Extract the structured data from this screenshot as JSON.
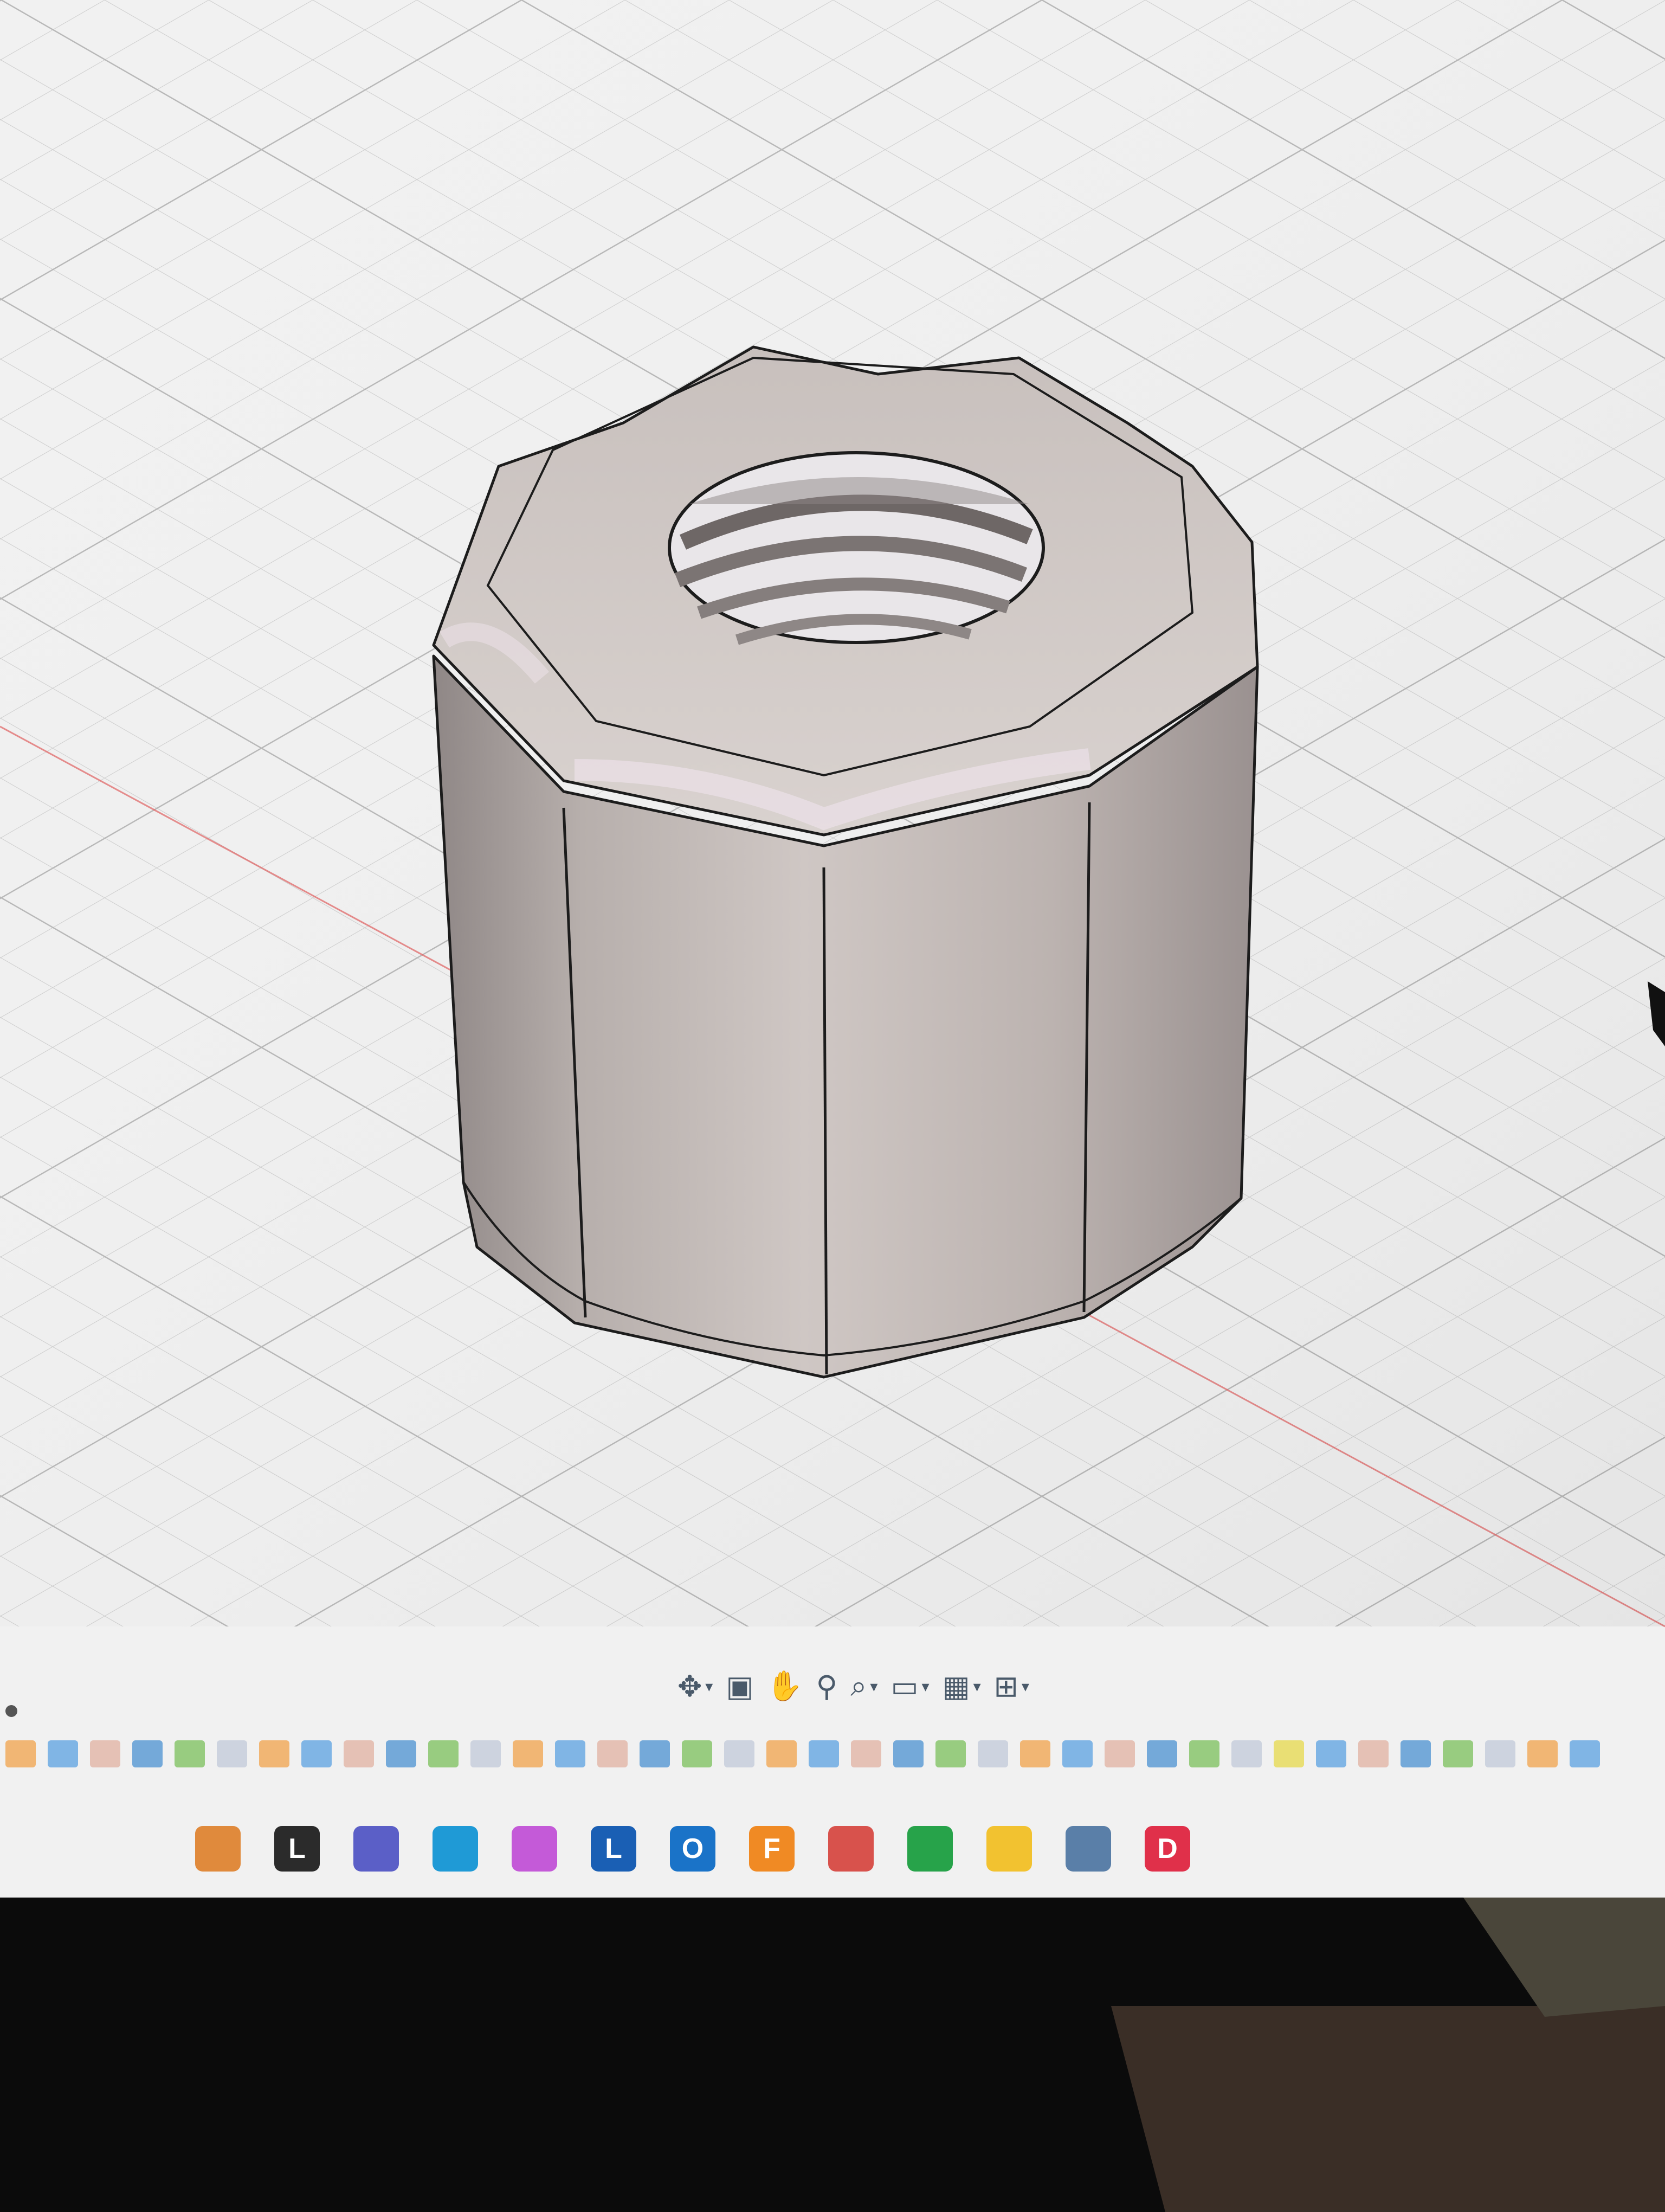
{
  "app": {
    "name": "3D CAD viewport",
    "accent": "#e6d84a"
  },
  "viewport": {
    "model": "octagonal knurled nut with threaded hole",
    "model_color": "#b9b0ae",
    "edge_color": "#1c1c1c",
    "grid_color": "#c9c9c9",
    "background": "#efefef",
    "axis_color": "#e05050"
  },
  "nav_toolbar": {
    "items": [
      {
        "name": "orbit-icon",
        "has_dropdown": true
      },
      {
        "name": "look-at-icon",
        "has_dropdown": false
      },
      {
        "name": "pan-icon",
        "has_dropdown": false
      },
      {
        "name": "zoom-icon",
        "has_dropdown": false
      },
      {
        "name": "fit-icon",
        "has_dropdown": true
      },
      {
        "name": "display-settings-icon",
        "has_dropdown": true
      },
      {
        "name": "grid-settings-icon",
        "has_dropdown": true
      },
      {
        "name": "viewports-icon",
        "has_dropdown": true
      }
    ]
  },
  "timeline": {
    "marker_count": 38,
    "active_marker": 30
  },
  "taskbar": {
    "apps": [
      {
        "name": "claude-app-icon",
        "color": "#e08a3c",
        "letter": ""
      },
      {
        "name": "l-app-icon",
        "color": "#2b2b2b",
        "letter": "L"
      },
      {
        "name": "teams-icon",
        "color": "#5b5fc7",
        "letter": ""
      },
      {
        "name": "edge-icon",
        "color": "#1f9ad6",
        "letter": ""
      },
      {
        "name": "copilot-icon",
        "color": "#c45ad8",
        "letter": ""
      },
      {
        "name": "linkedin-learning-icon",
        "color": "#1a5fb4",
        "letter": "L"
      },
      {
        "name": "outlook-icon",
        "color": "#1a73c8",
        "letter": "O"
      },
      {
        "name": "fusion-icon",
        "color": "#f08a24",
        "letter": "F"
      },
      {
        "name": "cube-app-icon",
        "color": "#d8524c",
        "letter": ""
      },
      {
        "name": "green-app-icon",
        "color": "#27a34a",
        "letter": ""
      },
      {
        "name": "file-explorer-icon",
        "color": "#f2c230",
        "letter": ""
      },
      {
        "name": "settings-icon",
        "color": "#5a7fa8",
        "letter": ""
      },
      {
        "name": "d-app-icon",
        "color": "#e0304a",
        "letter": "D"
      }
    ]
  }
}
